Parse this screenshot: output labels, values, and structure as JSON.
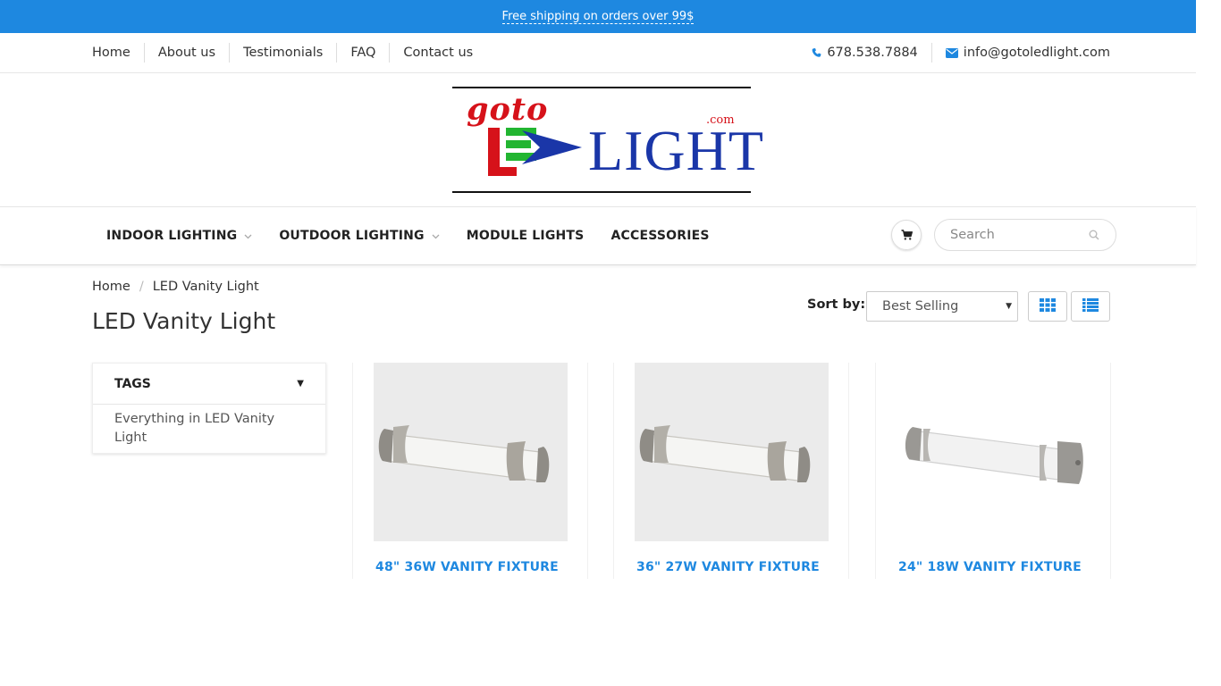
{
  "announcement": {
    "text": "Free shipping on orders over 99$"
  },
  "top_nav": {
    "items": [
      "Home",
      "About us",
      "Testimonials",
      "FAQ",
      "Contact us"
    ]
  },
  "contact": {
    "phone": "678.538.7884",
    "email": "info@gotoledlight.com",
    "phone_icon": "phone-icon",
    "email_icon": "envelope-icon"
  },
  "logo": {
    "goto": "goto",
    "com": ".com",
    "light": "LIGHT",
    "colors": {
      "red": "#d6121a",
      "green": "#22b531",
      "blue": "#1a36a8"
    }
  },
  "main_nav": {
    "items": [
      {
        "label": "INDOOR LIGHTING",
        "has_dropdown": true
      },
      {
        "label": "OUTDOOR LIGHTING",
        "has_dropdown": true
      },
      {
        "label": "MODULE LIGHTS",
        "has_dropdown": false
      },
      {
        "label": "ACCESSORIES",
        "has_dropdown": false
      }
    ],
    "cart_icon": "cart-icon",
    "search": {
      "placeholder": "Search",
      "icon": "search-icon"
    }
  },
  "breadcrumb": {
    "home": "Home",
    "current": "LED Vanity Light"
  },
  "page": {
    "title": "LED Vanity Light"
  },
  "sort": {
    "label": "Sort by:",
    "selected": "Best Selling"
  },
  "view_toggle": {
    "grid_icon": "grid-icon",
    "list_icon": "list-icon"
  },
  "sidebar": {
    "tags": {
      "title": "TAGS",
      "link": "Everything in LED Vanity Light"
    }
  },
  "products": [
    {
      "name": "48\" 36W VANITY FIXTURE"
    },
    {
      "name": "36\" 27W VANITY FIXTURE"
    },
    {
      "name": "24\" 18W VANITY FIXTURE"
    }
  ],
  "colors": {
    "accent": "#1e88e0",
    "text": "#333333"
  }
}
